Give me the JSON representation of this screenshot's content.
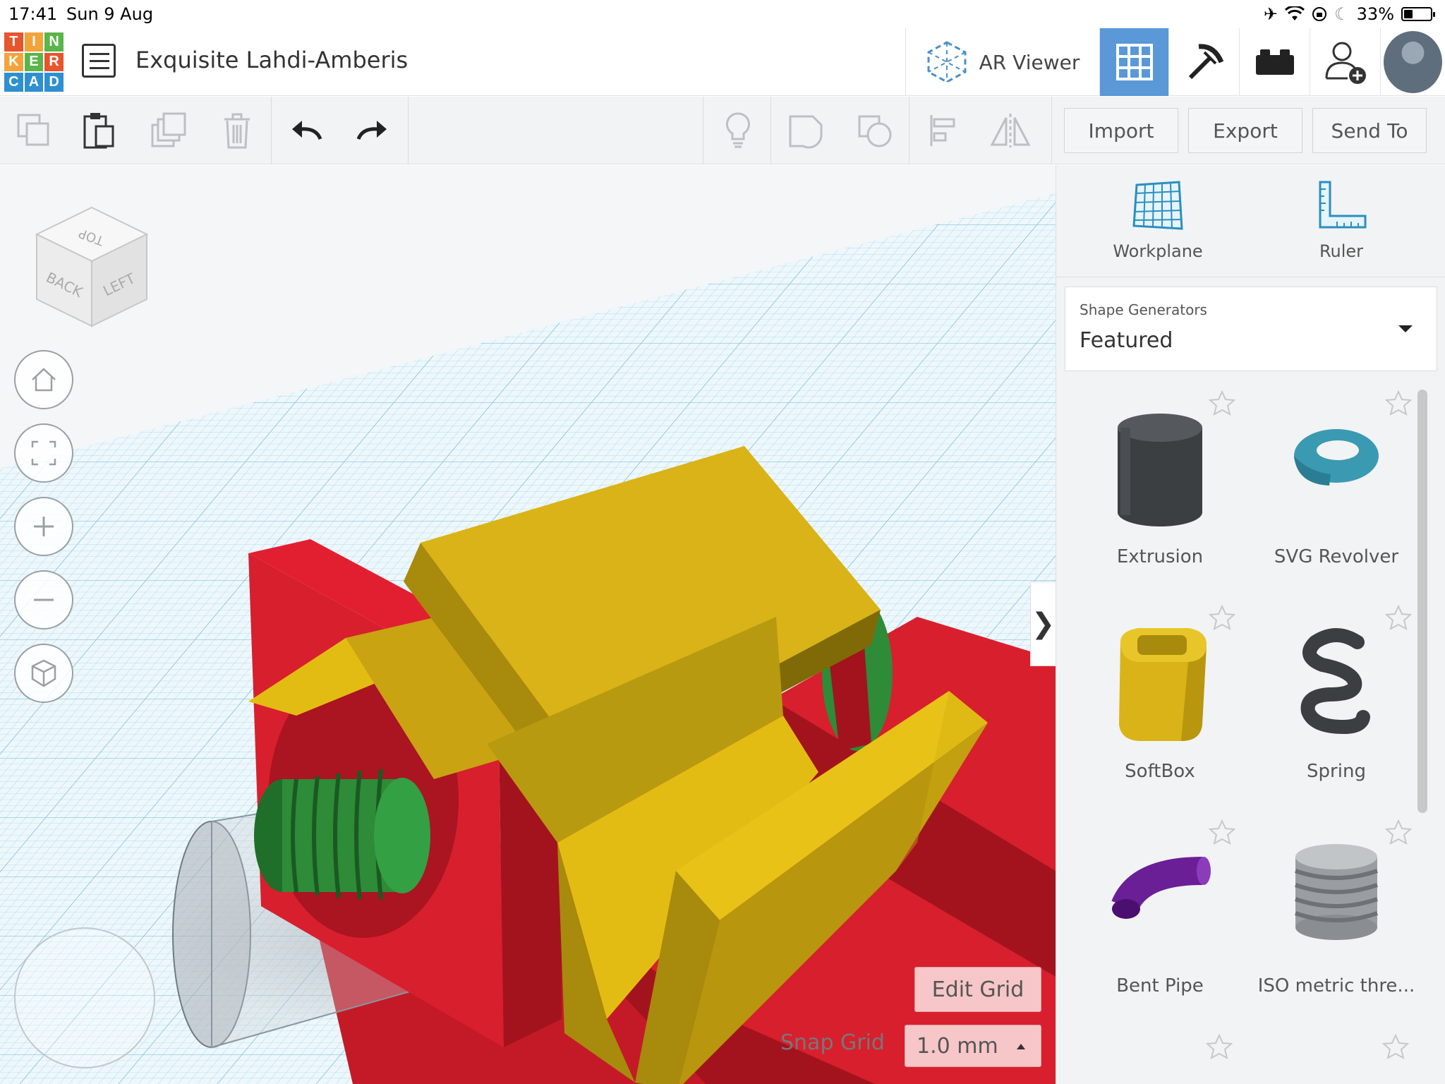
{
  "status_bar": {
    "time": "17:41",
    "date": "Sun 9 Aug",
    "battery": "33%",
    "battery_fraction": 0.33
  },
  "logo": {
    "letters": [
      "T",
      "I",
      "N",
      "K",
      "E",
      "R",
      "C",
      "A",
      "D"
    ],
    "colors": [
      "#e8542d",
      "#f3a33a",
      "#5ab54b",
      "#f3a33a",
      "#5ab54b",
      "#e8542d",
      "#2e90d1",
      "#2e90d1",
      "#2e90d1"
    ]
  },
  "header": {
    "project_title": "Exquisite Lahdi-Amberis",
    "ar_viewer_label": "AR Viewer",
    "active_view_color": "#5a98d8"
  },
  "toolbar": {
    "import_label": "Import",
    "export_label": "Export",
    "send_to_label": "Send To"
  },
  "viewport": {
    "nav_cube": {
      "top": "TOP",
      "back": "BACK",
      "left": "LEFT"
    },
    "edit_grid_label": "Edit Grid",
    "snap_grid_label": "Snap Grid",
    "snap_grid_value": "1.0 mm",
    "colors": {
      "red": "#d81f2e",
      "yellow": "#e3bc13",
      "green": "#2e8b38",
      "grid": "#9fd3ea"
    }
  },
  "panel": {
    "tools": [
      {
        "label": "Workplane",
        "icon": "workplane-icon"
      },
      {
        "label": "Ruler",
        "icon": "ruler-icon"
      }
    ],
    "generators_label": "Shape Generators",
    "generators_value": "Featured",
    "shapes": [
      {
        "label": "Extrusion",
        "icon": "extrusion-icon"
      },
      {
        "label": "SVG Revolver",
        "icon": "svg-revolver-icon"
      },
      {
        "label": "SoftBox",
        "icon": "softbox-icon"
      },
      {
        "label": "Spring",
        "icon": "spring-icon"
      },
      {
        "label": "Bent Pipe",
        "icon": "bent-pipe-icon"
      },
      {
        "label": "ISO metric thre...",
        "icon": "iso-thread-icon"
      }
    ]
  }
}
